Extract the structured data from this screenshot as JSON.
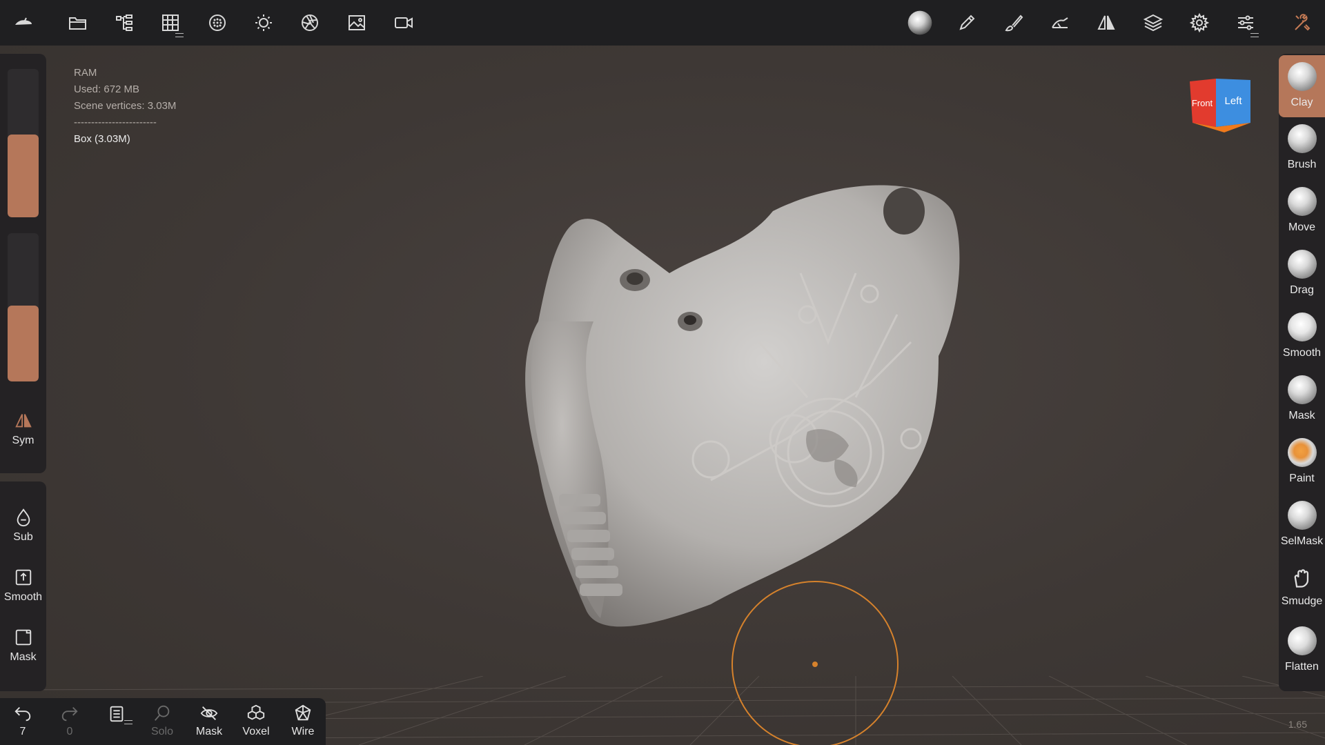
{
  "info": {
    "ram_label": "RAM",
    "used": "Used: 672 MB",
    "scene_vertices": "Scene vertices: 3.03M",
    "separator": "------------------------",
    "object": "Box (3.03M)"
  },
  "left_panel": {
    "sym_label": "Sym",
    "sub_label": "Sub",
    "smooth_label": "Smooth",
    "mask_label": "Mask",
    "radius_level": 0.56,
    "intensity_level": 0.51
  },
  "bottom_bar": {
    "undo_count": "7",
    "redo_count": "0",
    "solo_label": "Solo",
    "mask_label": "Mask",
    "voxel_label": "Voxel",
    "wire_label": "Wire"
  },
  "tools": [
    {
      "label": "Clay",
      "active": true
    },
    {
      "label": "Brush",
      "active": false
    },
    {
      "label": "Move",
      "active": false
    },
    {
      "label": "Drag",
      "active": false
    },
    {
      "label": "Smooth",
      "active": false
    },
    {
      "label": "Mask",
      "active": false
    },
    {
      "label": "Paint",
      "active": false
    },
    {
      "label": "SelMask",
      "active": false
    },
    {
      "label": "Smudge",
      "active": false
    },
    {
      "label": "Flatten",
      "active": false
    }
  ],
  "view_cube": {
    "front_label": "Front",
    "left_label": "Left"
  },
  "zoom_readout": "1.65",
  "colors": {
    "accent": "#b5775a",
    "cursor": "#d6822c",
    "cube_front": "#e23b2e",
    "cube_left": "#3d8ee0"
  },
  "icons": {
    "top_left": [
      "logo-icon",
      "folder-icon",
      "scene-tree-icon",
      "grid-icon",
      "dots-globe-icon",
      "sun-icon",
      "aperture-icon",
      "image-icon",
      "camera-icon"
    ],
    "top_right": [
      "material-sphere-icon",
      "pencil-icon",
      "brush-icon",
      "stroke-icon",
      "symmetry-icon",
      "layers-icon",
      "gear-icon",
      "sliders-icon",
      "tools-icon"
    ]
  }
}
